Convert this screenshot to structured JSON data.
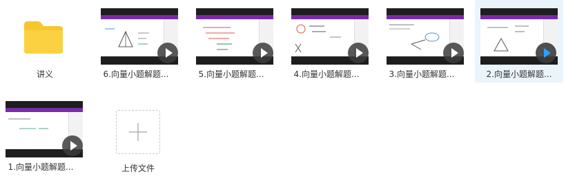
{
  "files": {
    "folder": {
      "name": "讲义",
      "icon": "folder-icon"
    },
    "videos": [
      {
        "name": "6.向量小题解题...",
        "selected": false
      },
      {
        "name": "5.向量小题解题...",
        "selected": false
      },
      {
        "name": "4.向量小题解题...",
        "selected": false
      },
      {
        "name": "3.向量小题解题...",
        "selected": false
      },
      {
        "name": "2.向量小题解题...",
        "selected": true
      },
      {
        "name": "1.向量小题解题...",
        "selected": false
      }
    ],
    "upload": {
      "label": "上传文件",
      "icon": "plus-icon"
    }
  },
  "colors": {
    "folder": "#f7c52e",
    "selected_bg": "#eaf4fd",
    "play_active": "#2aa1ff",
    "video_topbar": "#7a2aa8"
  }
}
